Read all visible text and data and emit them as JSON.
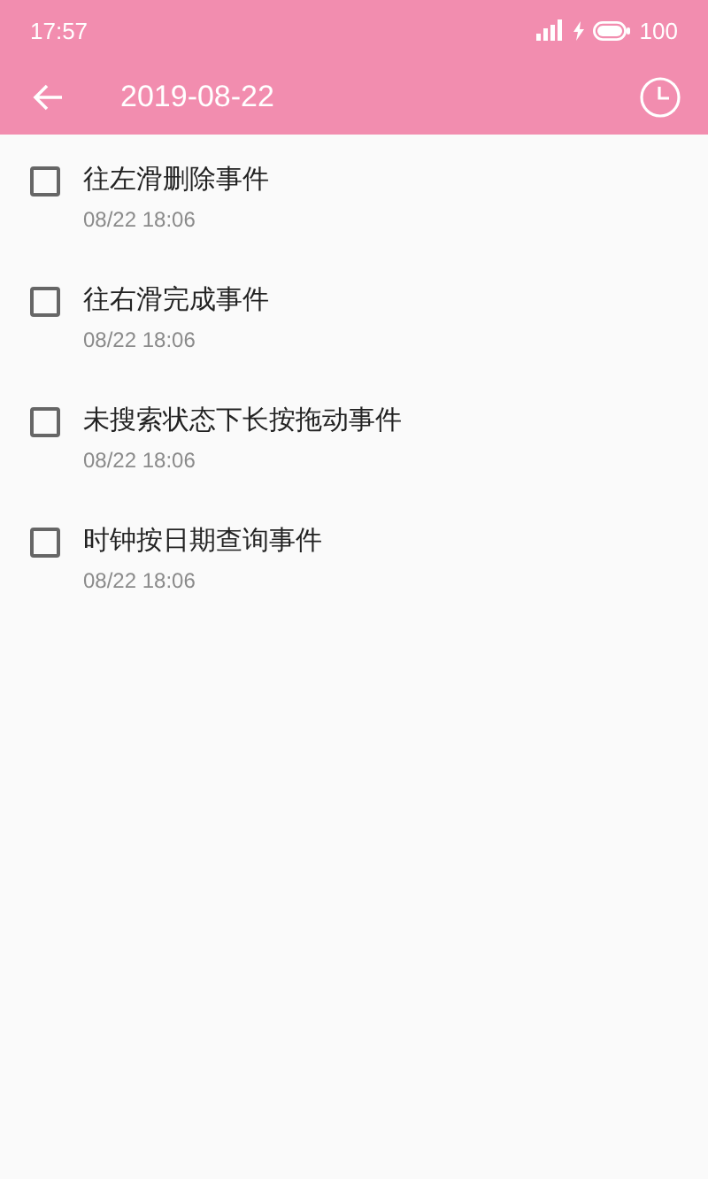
{
  "status_bar": {
    "time": "17:57",
    "battery": "100"
  },
  "toolbar": {
    "title": "2019-08-22"
  },
  "events": [
    {
      "title": "往左滑删除事件",
      "time": "08/22 18:06",
      "checked": false
    },
    {
      "title": "往右滑完成事件",
      "time": "08/22 18:06",
      "checked": false
    },
    {
      "title": "未搜索状态下长按拖动事件",
      "time": "08/22 18:06",
      "checked": false
    },
    {
      "title": "时钟按日期查询事件",
      "time": "08/22 18:06",
      "checked": false
    }
  ]
}
